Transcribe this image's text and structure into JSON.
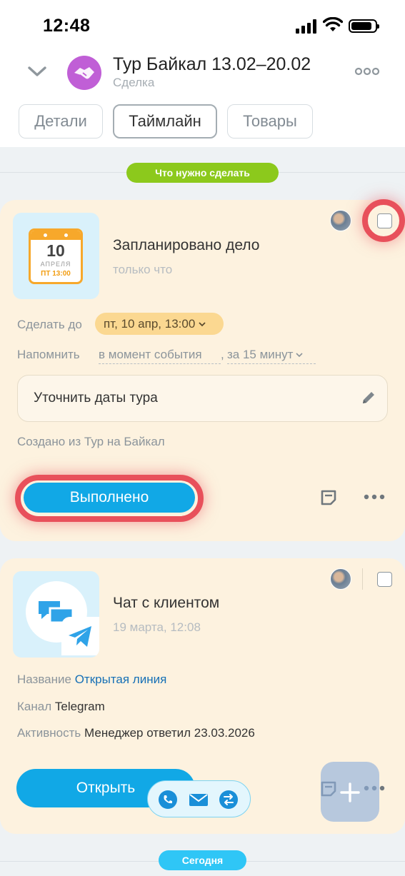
{
  "status_bar": {
    "time": "12:48"
  },
  "header": {
    "title": "Тур Байкал 13.02–20.02",
    "subtitle": "Сделка",
    "tabs": [
      {
        "label": "Детали",
        "active": false
      },
      {
        "label": "Таймлайн",
        "active": true
      },
      {
        "label": "Товары",
        "active": false
      }
    ]
  },
  "sections": {
    "todo_label": "Что нужно сделать",
    "todo_color": "#8cc91c",
    "today_label": "Сегодня",
    "today_color": "#2fc6f6"
  },
  "task_card": {
    "calendar": {
      "day": "10",
      "month": "АПРЕЛЯ",
      "time": "ПТ 13:00"
    },
    "title": "Запланировано дело",
    "time": "только что",
    "deadline_label": "Сделать до",
    "deadline_value": "пт, 10 апр, 13:00",
    "remind_label": "Напомнить",
    "remind_values": [
      "в момент события",
      "за 15 минут"
    ],
    "note": "Уточнить даты тура",
    "created_from": "Создано из Тур на Байкал",
    "done_button": "Выполнено"
  },
  "chat_card": {
    "title": "Чат с клиентом",
    "time": "19 марта, 12:08",
    "name_label": "Название",
    "name_value": "Открытая линия",
    "channel_label": "Канал",
    "channel_value": "Telegram",
    "activity_label": "Активность",
    "activity_value": "Менеджер ответил 23.03.2026",
    "open_button": "Открыть"
  },
  "colors": {
    "accent": "#11a8e6",
    "highlight": "#e8505b",
    "card_bg": "#fdf2df",
    "deadline_pill": "#fbd891"
  },
  "icons": {
    "deal": "handshake-icon",
    "comm": [
      "phone-icon",
      "mail-icon",
      "transfer-icon"
    ],
    "fab": "plus-icon"
  }
}
